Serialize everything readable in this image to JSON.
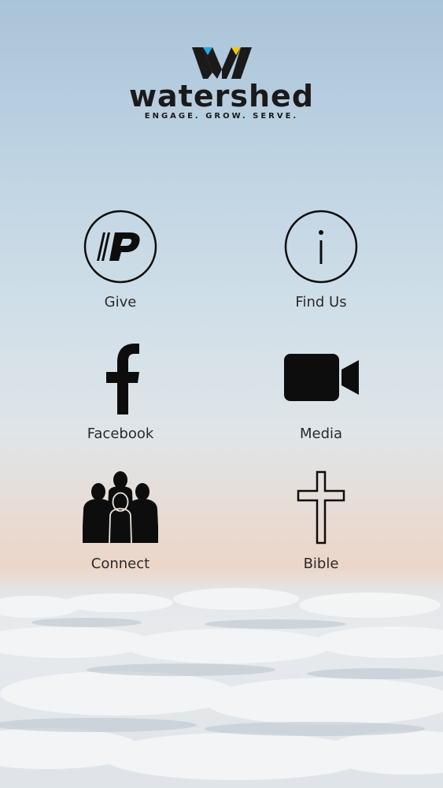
{
  "brand": {
    "name": "watershed",
    "tagline": "ENGAGE. GROW. SERVE."
  },
  "menu": [
    {
      "label": "Give",
      "icon": "pushpay-p-icon"
    },
    {
      "label": "Find Us",
      "icon": "info-icon"
    },
    {
      "label": "Facebook",
      "icon": "facebook-icon"
    },
    {
      "label": "Media",
      "icon": "video-camera-icon"
    },
    {
      "label": "Connect",
      "icon": "people-group-icon"
    },
    {
      "label": "Bible",
      "icon": "cross-icon"
    }
  ],
  "colors": {
    "icon": "#0d0d0d",
    "logo_blue": "#29a8e0",
    "logo_yellow": "#f5c518"
  }
}
